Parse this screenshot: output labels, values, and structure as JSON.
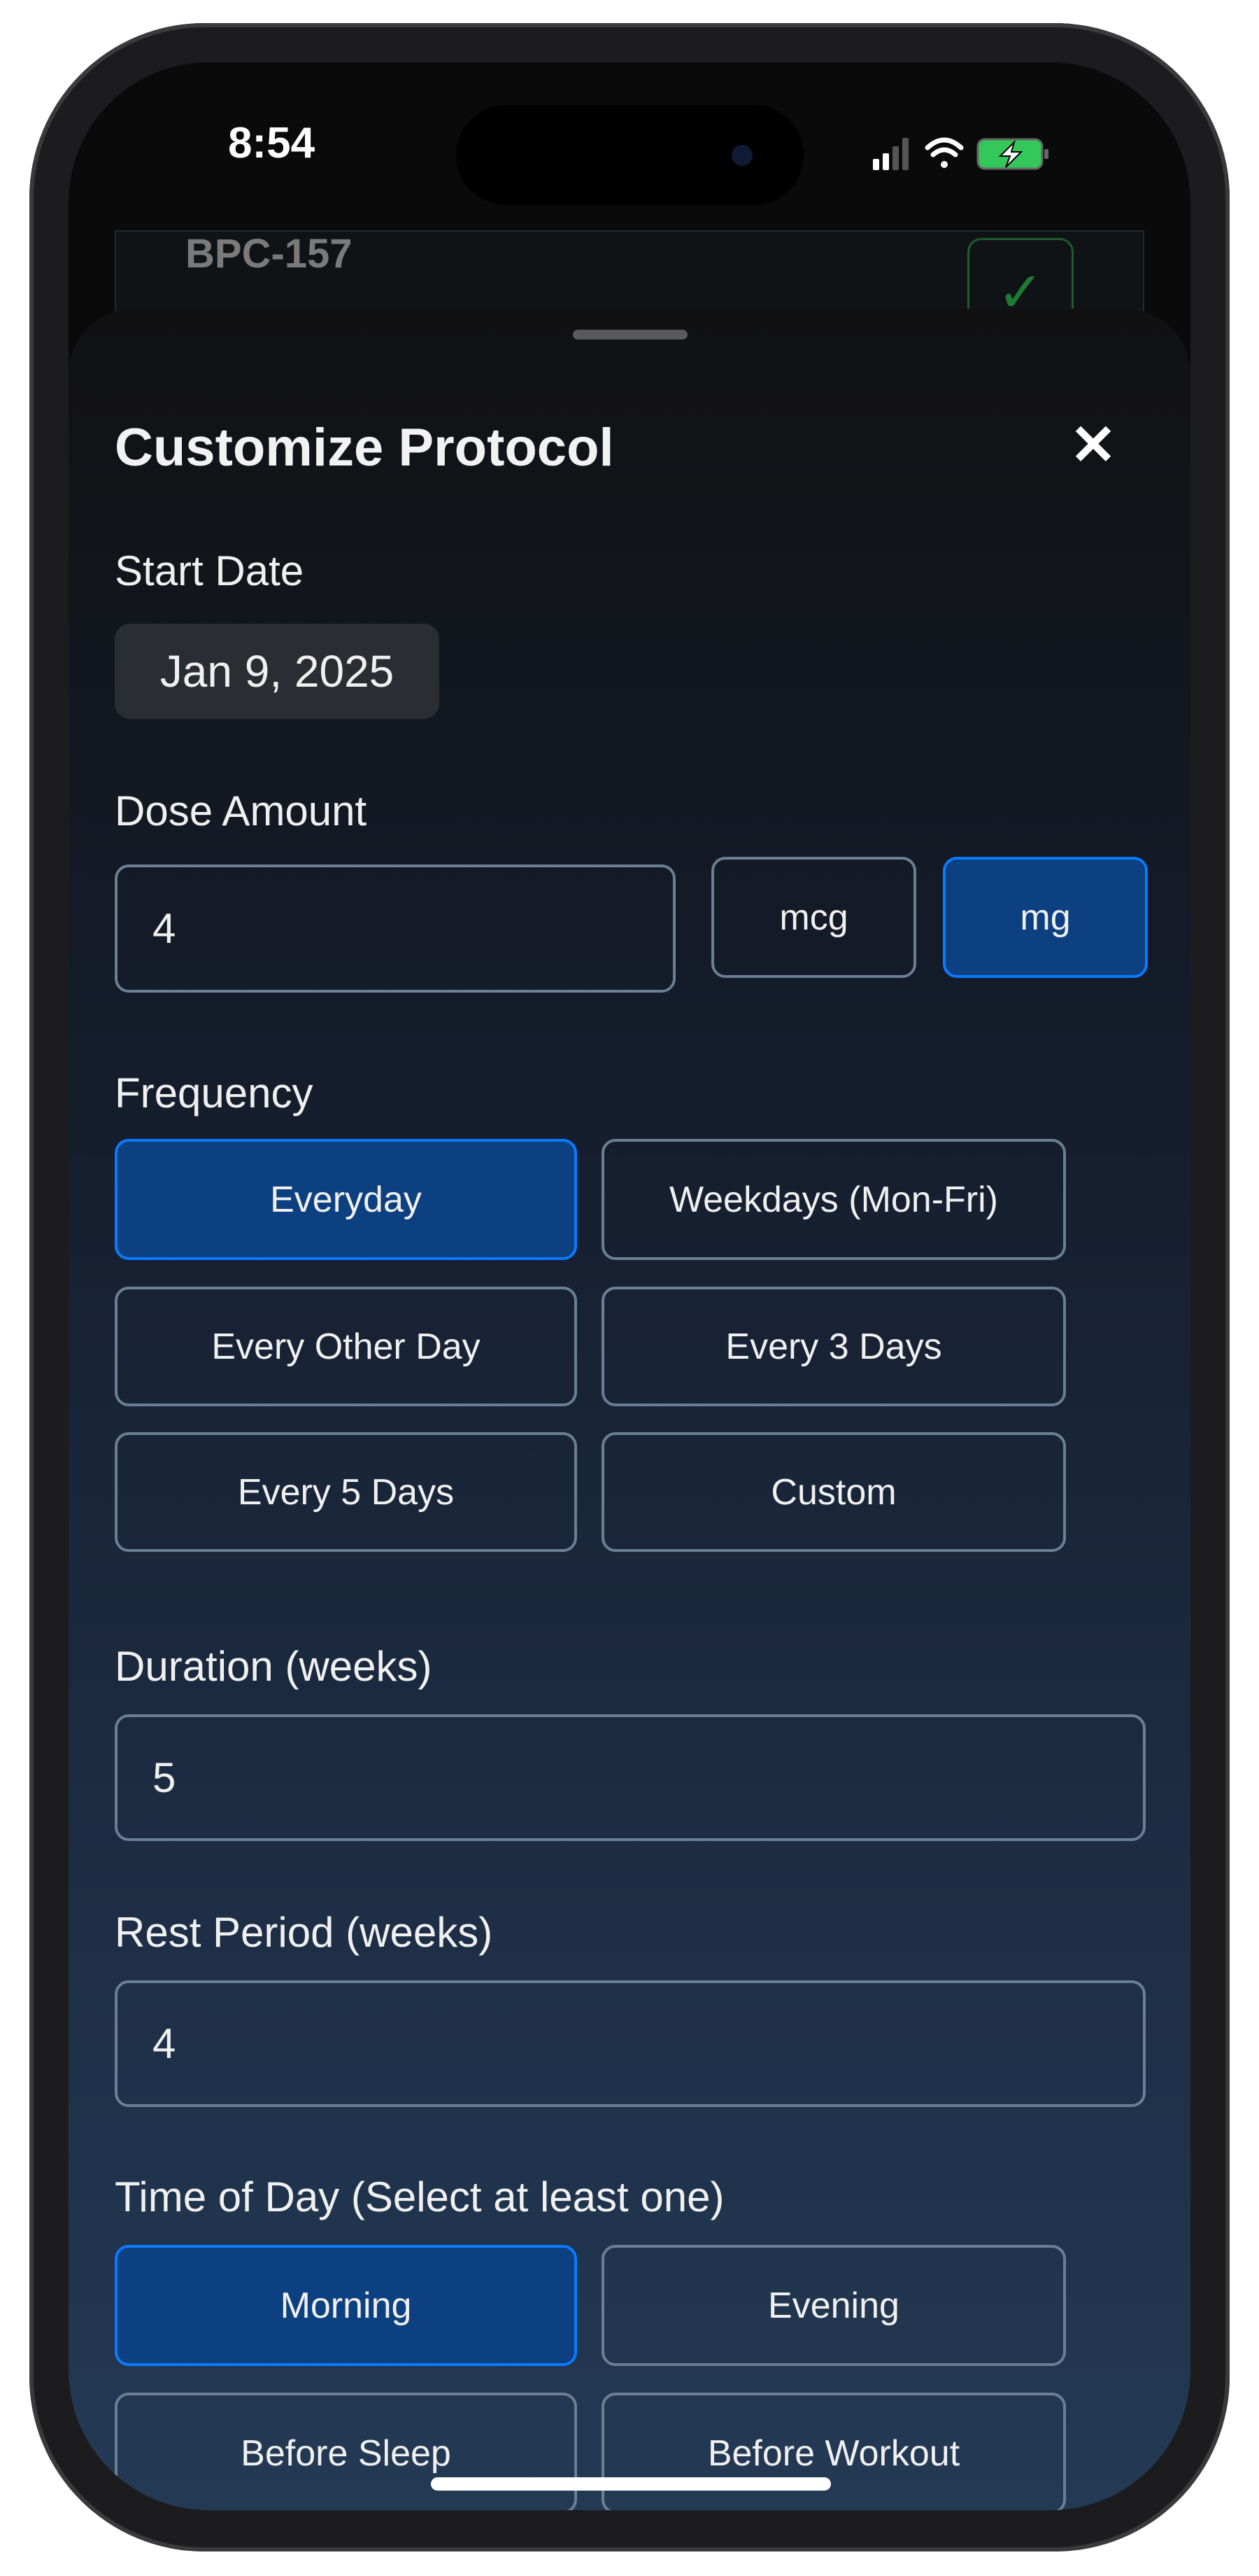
{
  "status_bar": {
    "time": "8:54",
    "icons": [
      "cellular-signal-icon",
      "wifi-icon",
      "battery-charging-icon"
    ]
  },
  "background_card": {
    "title": "BPC-157",
    "checked": true
  },
  "sheet": {
    "title": "Customize Protocol",
    "close_icon": "close-icon",
    "start_date": {
      "label": "Start Date",
      "value": "Jan 9, 2025"
    },
    "dose": {
      "label": "Dose Amount",
      "value": "4",
      "units": [
        {
          "label": "mcg",
          "selected": false
        },
        {
          "label": "mg",
          "selected": true
        }
      ]
    },
    "frequency": {
      "label": "Frequency",
      "options": [
        {
          "label": "Everyday",
          "selected": true
        },
        {
          "label": "Weekdays (Mon-Fri)",
          "selected": false
        },
        {
          "label": "Every Other Day",
          "selected": false
        },
        {
          "label": "Every 3 Days",
          "selected": false
        },
        {
          "label": "Every 5 Days",
          "selected": false
        },
        {
          "label": "Custom",
          "selected": false
        }
      ]
    },
    "duration": {
      "label": "Duration (weeks)",
      "value": "5"
    },
    "rest": {
      "label": "Rest Period (weeks)",
      "value": "4"
    },
    "time_of_day": {
      "label": "Time of Day (Select at least one)",
      "options": [
        {
          "label": "Morning",
          "selected": true
        },
        {
          "label": "Evening",
          "selected": false
        },
        {
          "label": "Before Sleep",
          "selected": false
        },
        {
          "label": "Before Workout",
          "selected": false
        }
      ]
    }
  },
  "colors": {
    "accent": "#0a7aff",
    "selected_fill": "#0c4080",
    "border": "#6a7f93",
    "battery": "#34c759"
  }
}
